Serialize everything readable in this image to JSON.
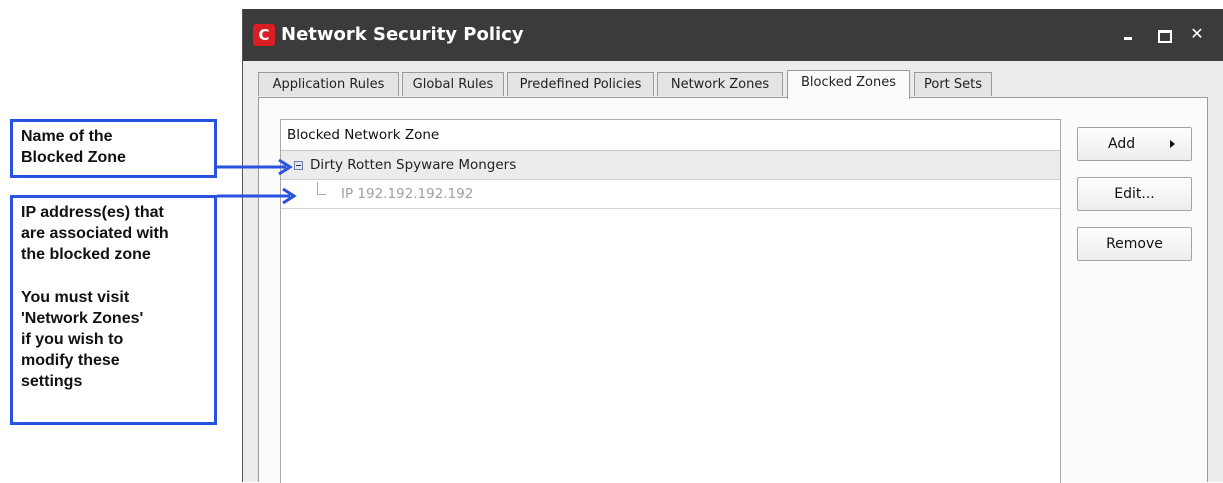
{
  "callouts": {
    "zone_name": {
      "line1": "Name of the",
      "line2": "Blocked Zone"
    },
    "ip_info": {
      "line1": "IP address(es) that",
      "line2": "are associated with",
      "line3": "the blocked zone",
      "line4": "You must visit",
      "line5": "'Network Zones'",
      "line6": "if you wish to",
      "line7": "modify these",
      "line8": "settings"
    },
    "accent_color": "#2a52e0"
  },
  "window": {
    "logo_letter": "C",
    "title": "Network Security Policy",
    "controls": {
      "minimize": "minimize",
      "maximize": "maximize",
      "close": "✕"
    }
  },
  "tabs": [
    {
      "label": "Application Rules"
    },
    {
      "label": "Global Rules"
    },
    {
      "label": "Predefined Policies"
    },
    {
      "label": "Network Zones"
    },
    {
      "label": "Blocked Zones",
      "active": true
    },
    {
      "label": "Port Sets"
    }
  ],
  "list": {
    "header": "Blocked Network Zone",
    "zone_name": "Dirty Rotten Spyware Mongers",
    "ip_entry": "IP 192.192.192.192"
  },
  "buttons": {
    "add": "Add",
    "edit": "Edit...",
    "remove": "Remove"
  }
}
